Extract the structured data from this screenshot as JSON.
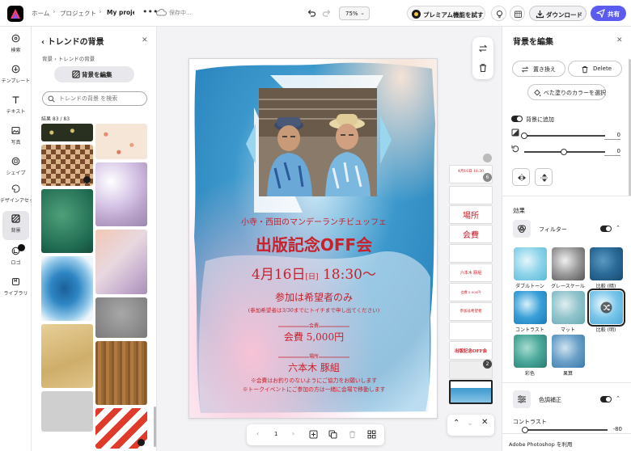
{
  "header": {
    "breadcrumb": [
      "ホーム",
      "プロジェクト"
    ],
    "doc_title": "My proje",
    "save_status": "保存中...",
    "zoom": "75%",
    "premium_label": "プレミアム機能を試す",
    "download_label": "ダウンロード",
    "share_label": "共有"
  },
  "rail": {
    "items": [
      {
        "label": "検索",
        "icon": "search-icon"
      },
      {
        "label": "テンプレート",
        "icon": "template-icon"
      },
      {
        "label": "テキスト",
        "icon": "text-icon"
      },
      {
        "label": "写真",
        "icon": "photo-icon"
      },
      {
        "label": "シェイプ",
        "icon": "shape-icon"
      },
      {
        "label": "デザインアセット",
        "icon": "design-assets-icon"
      },
      {
        "label": "背景",
        "icon": "background-icon"
      },
      {
        "label": "ロゴ",
        "icon": "logo-icon"
      },
      {
        "label": "ライブラリ",
        "icon": "library-icon"
      }
    ]
  },
  "left_panel": {
    "title": "トレンドの背景",
    "breadcrumb_root": "背景",
    "breadcrumb_current": "トレンドの背景",
    "edit_button": "背景を編集",
    "search_placeholder": "トレンドの背景 を検索",
    "result_count": "結果 83 / 83"
  },
  "poster": {
    "subtitle": "小寺・西田のマンデーランチビュッフェ",
    "headline": "出版記念OFF会",
    "date": "4月16日",
    "weekday": "日",
    "time": "18:30〜",
    "attendance": "参加は希望者のみ",
    "note": "(参加希望者は3/30までにトイチまで申し出てください)",
    "fee_label": "会費",
    "fee_value": "会費 5,000円",
    "venue_label": "場所",
    "venue_value": "六本木 豚組",
    "footnote1": "※会費はお釣りのないようにご協力をお願いします",
    "footnote2": "※トークイベントにご参加の方は一緒に会場で移動します"
  },
  "pages_strip": {
    "top_number": "6",
    "bottom_number": "2",
    "items": [
      "4月16日 18:30",
      "",
      "場所",
      "会費",
      "",
      "六本木 豚組",
      "会費 5,000円",
      "参加は希望者",
      "",
      "出版記念OFF会",
      ""
    ]
  },
  "pager": {
    "page_number": "1"
  },
  "right_panel": {
    "title": "背景を編集",
    "replace_button": "置き換え",
    "delete_button": "Delete",
    "fill_color_button": "べた塗りのカラーを選択",
    "add_background_label": "背景に追加",
    "slider1_value": "0",
    "slider2_value": "0",
    "effects_heading": "効果",
    "filter_label": "フィルター",
    "filters": [
      "ダブルトーン",
      "グレースケール",
      "比較 (暗)",
      "コントラスト",
      "マット",
      "比較 (明)",
      "彩色",
      "果算"
    ],
    "color_adjust_label": "色調補正",
    "contrast_label": "コントラスト",
    "contrast_value": "-80",
    "footer": "Adobe Photoshop を利用"
  },
  "colors": {
    "accent": "#5b5bf0",
    "poster_red": "#c9202a",
    "watercolor_blue": "#2e8bbf",
    "watercolor_pink": "#f4b6cf"
  }
}
